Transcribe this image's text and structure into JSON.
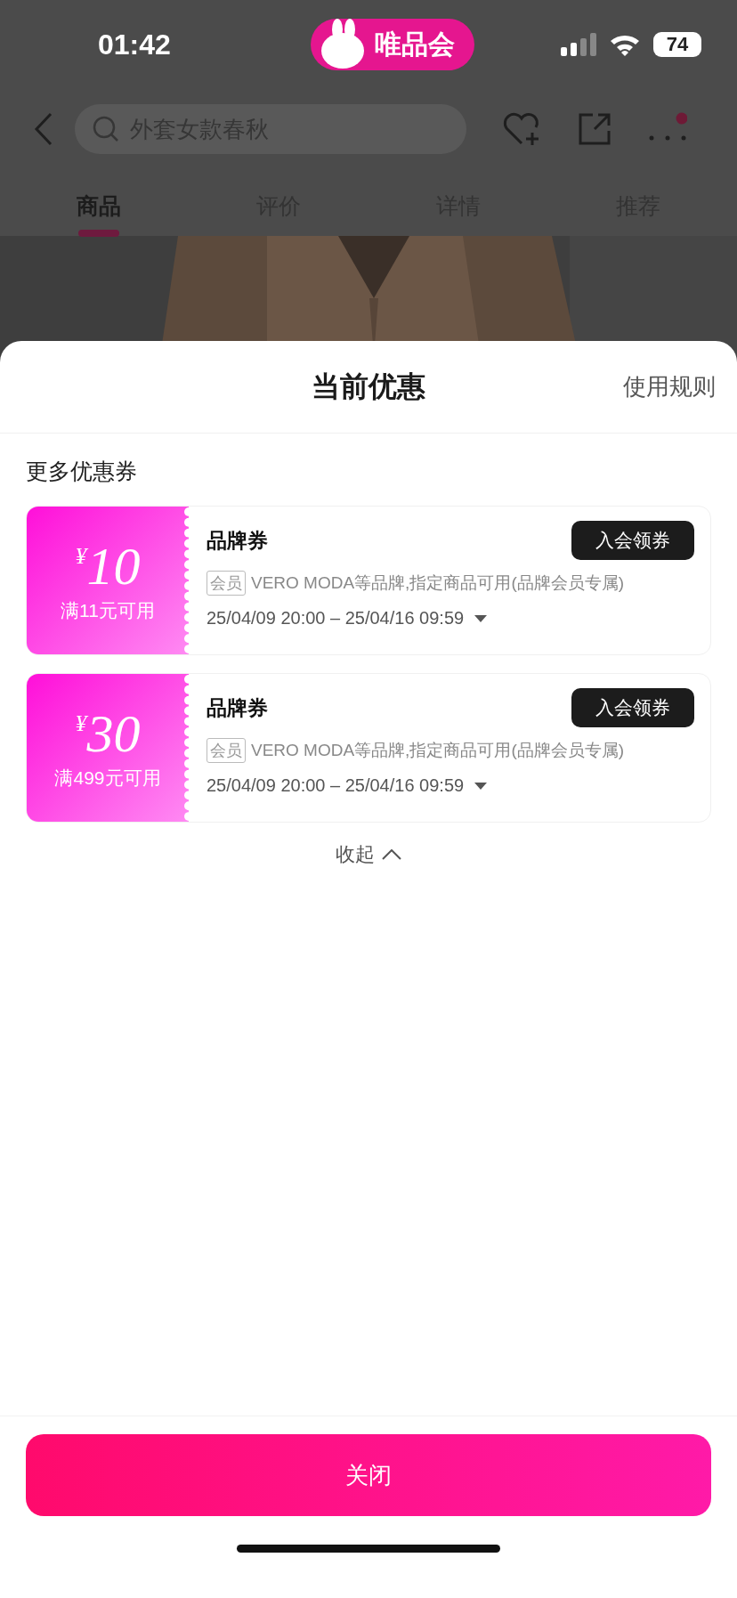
{
  "status_bar": {
    "time": "01:42",
    "app_badge": "唯品会",
    "battery": "74"
  },
  "nav": {
    "search": {
      "placeholder": "外套女款春秋"
    }
  },
  "tabs": [
    {
      "label": "商品",
      "selected": true
    },
    {
      "label": "评价",
      "selected": false
    },
    {
      "label": "详情",
      "selected": false
    },
    {
      "label": "推荐",
      "selected": false
    }
  ],
  "sheet": {
    "title": "当前优惠",
    "rules_link": "使用规则",
    "section_title": "更多优惠券",
    "coupons": [
      {
        "currency": "¥",
        "amount": "10",
        "condition": "满11元可用",
        "name": "品牌券",
        "action": "入会领券",
        "tag": "会员",
        "description": "VERO MODA等品牌,指定商品可用(品牌会员专属)",
        "validity": "25/04/09 20:00 – 25/04/16 09:59"
      },
      {
        "currency": "¥",
        "amount": "30",
        "condition": "满499元可用",
        "name": "品牌券",
        "action": "入会领券",
        "tag": "会员",
        "description": "VERO MODA等品牌,指定商品可用(品牌会员专属)",
        "validity": "25/04/09 20:00 – 25/04/16 09:59"
      }
    ],
    "collapse": "收起",
    "close_button": "关闭"
  }
}
